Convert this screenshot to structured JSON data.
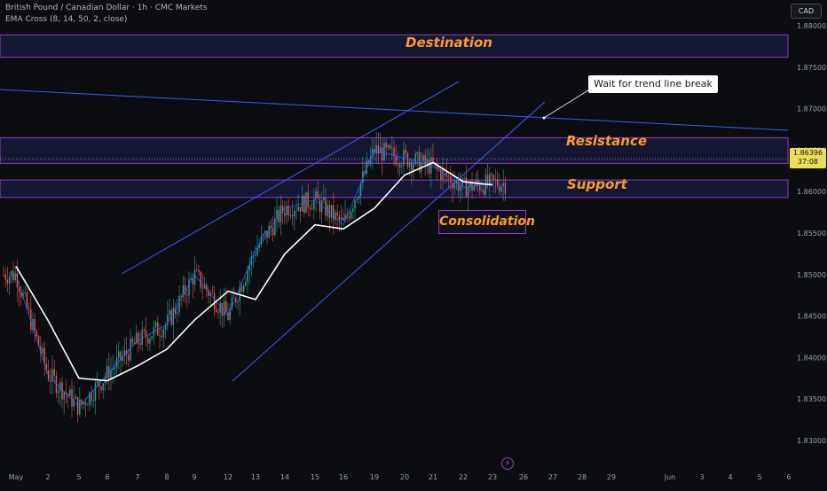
{
  "header": {
    "title": "British Pound / Canadian Dollar · 1h · CMC Markets",
    "indicator": "EMA Cross (8, 14, 50, 2, close)"
  },
  "currency_button": "CAD",
  "price_badge": {
    "price": "1.86396",
    "countdown": "37:08"
  },
  "annotations": {
    "destination": "Destination",
    "resistance": "Resistance",
    "support": "Support",
    "consolidation": "Consolidation",
    "callout": "Wait for trend line break"
  },
  "colors": {
    "background": "#0c0d10",
    "zone_border": "#9b37c8",
    "zone_fill": "#1b2050",
    "trendline": "#3d5afe",
    "label_orange": "#ff9a26",
    "ema_slow": "#ffffff",
    "current_price": "#eadf55"
  },
  "chart_data": {
    "type": "line",
    "title": "British Pound / Canadian Dollar · 1h · CMC Markets",
    "y_axis": {
      "ticks": [
        "1.88000",
        "1.87500",
        "1.87000",
        "1.86500",
        "1.86000",
        "1.85500",
        "1.85000",
        "1.84500",
        "1.84000",
        "1.83500",
        "1.83000"
      ],
      "ylim": [
        1.8275,
        1.8815
      ]
    },
    "x_axis": {
      "ticks": [
        "May",
        "2",
        "5",
        "6",
        "7",
        "8",
        "9",
        "12",
        "13",
        "14",
        "15",
        "16",
        "19",
        "20",
        "21",
        "22",
        "23",
        "26",
        "27",
        "28",
        "29",
        "Jun",
        "3",
        "4",
        "5",
        "6"
      ]
    },
    "zones": [
      {
        "name": "Destination",
        "from": 1.8762,
        "to": 1.8789
      },
      {
        "name": "Resistance",
        "from": 1.8634,
        "to": 1.8665
      },
      {
        "name": "Support",
        "from": 1.8593,
        "to": 1.8614
      }
    ],
    "current_price": 1.86396,
    "series": [
      {
        "name": "EMA 50",
        "x": [
          "May",
          "2",
          "5",
          "6",
          "7",
          "8",
          "9",
          "12",
          "13",
          "14",
          "15",
          "16",
          "19",
          "20",
          "21",
          "22",
          "23"
        ],
        "values": [
          1.851,
          1.8445,
          1.8375,
          1.8372,
          1.839,
          1.841,
          1.8445,
          1.848,
          1.847,
          1.8525,
          1.856,
          1.8555,
          1.858,
          1.862,
          1.8635,
          1.8612,
          1.8608
        ]
      },
      {
        "name": "EMA 8",
        "x": [
          "May",
          "2",
          "5",
          "6",
          "7",
          "8",
          "9",
          "12",
          "13",
          "14",
          "15",
          "16",
          "19",
          "20",
          "21",
          "22",
          "23"
        ],
        "values": [
          1.85,
          1.838,
          1.834,
          1.838,
          1.842,
          1.844,
          1.85,
          1.845,
          1.853,
          1.858,
          1.859,
          1.856,
          1.865,
          1.864,
          1.863,
          1.8605,
          1.861
        ]
      }
    ]
  }
}
